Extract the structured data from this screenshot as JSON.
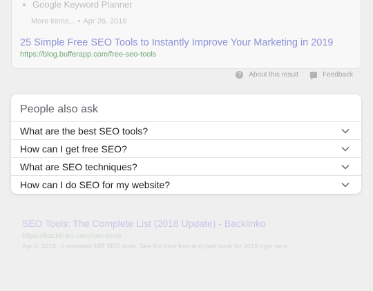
{
  "top_result": {
    "bullet_text": "Google Keyword Planner",
    "more_items": "More items...",
    "date": "Apr 26, 2018",
    "title": "25 Simple Free SEO Tools to Instantly Improve Your Marketing in 2019",
    "url": "https://blog.bufferapp.com/free-seo-tools"
  },
  "result_footer": {
    "about_label": "About this result",
    "feedback_label": "Feedback"
  },
  "people_also_ask": {
    "heading": "People also ask",
    "questions": [
      "What are the best SEO tools?",
      "How can I get free SEO?",
      "What are SEO techniques?",
      "How can I do SEO for my website?"
    ]
  },
  "faded_result": {
    "title": "SEO Tools: The Complete List (2018 Update) - Backlinko",
    "url": "https://backlinko.com/seo-tools",
    "snippet": "Apr 4, 2018 - I reviewed 188 SEO tools. See the best free and paid tools for 2018 right here."
  },
  "colors": {
    "overlay_bg": "#efefef",
    "link_title": "#8c92d8",
    "url_green": "#6fa874",
    "question_text": "#222222"
  },
  "icons": {
    "help": "help-circle-icon",
    "feedback": "feedback-flag-icon",
    "expand": "chevron-down-icon"
  }
}
